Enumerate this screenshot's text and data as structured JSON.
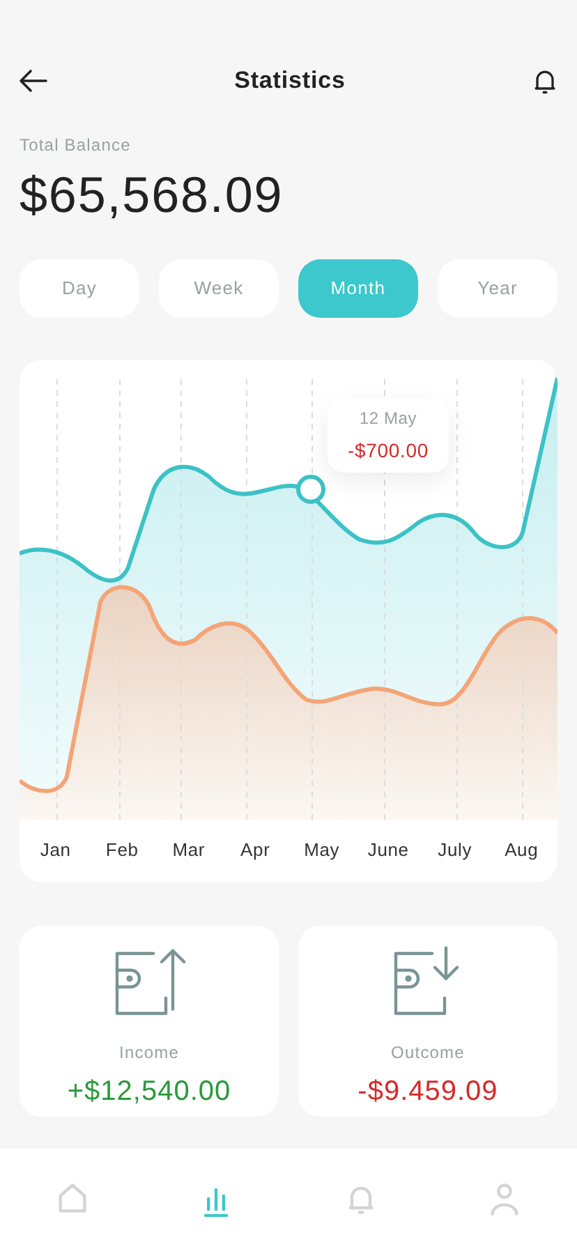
{
  "header": {
    "title": "Statistics"
  },
  "balance": {
    "label": "Total Balance",
    "value": "$65,568.09"
  },
  "tabs": [
    {
      "label": "Day",
      "selected": false
    },
    {
      "label": "Week",
      "selected": false
    },
    {
      "label": "Month",
      "selected": true
    },
    {
      "label": "Year",
      "selected": false
    }
  ],
  "chart": {
    "months": [
      "Jan",
      "Feb",
      "Mar",
      "Apr",
      "May",
      "June",
      "July",
      "Aug"
    ],
    "tooltip": {
      "date": "12 May",
      "amount": "-$700.00"
    }
  },
  "summary": [
    {
      "kind": "income",
      "label": "Income",
      "amount": "+$12,540.00"
    },
    {
      "kind": "outcome",
      "label": "Outcome",
      "amount": "-$9.459.09"
    }
  ],
  "nav": [
    {
      "kind": "home",
      "selected": false
    },
    {
      "kind": "stats",
      "selected": true
    },
    {
      "kind": "bell",
      "selected": false
    },
    {
      "kind": "profile",
      "selected": false
    }
  ]
}
